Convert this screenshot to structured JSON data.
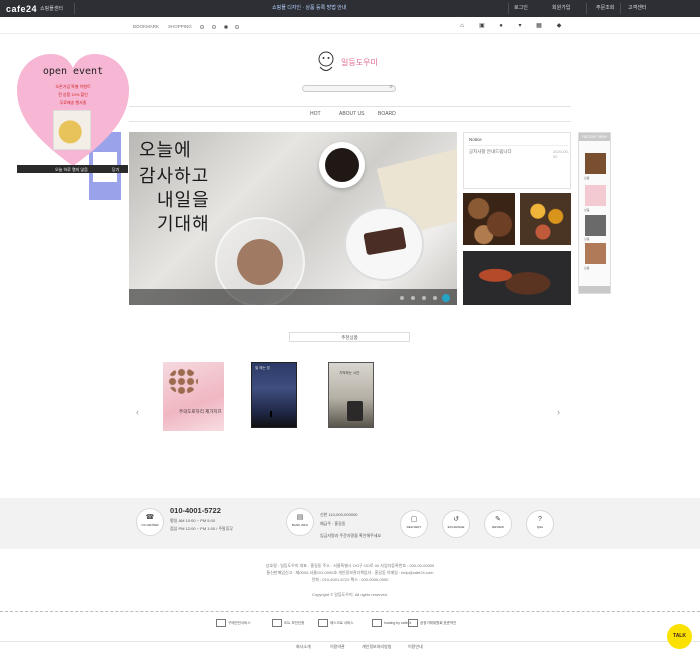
{
  "topbar": {
    "logo": "cafe24",
    "logo_sub": "쇼핑몰센터",
    "notice": "쇼핑몰 디자인 · 상품 등록 방법 안내",
    "items": [
      "로그인",
      "회원가입",
      "주문조회",
      "고객센터"
    ]
  },
  "shopbar": {
    "links": [
      "BOOKMARK",
      "SHOPPING"
    ],
    "icons": [
      "home-icon",
      "lock-icon",
      "user-icon",
      "cart-icon",
      "grid-icon",
      "bag-icon"
    ]
  },
  "brand": {
    "name": "일등도우미"
  },
  "search": {
    "placeholder": ""
  },
  "nav": {
    "items": [
      "HOT",
      "ABOUT US",
      "BOARD"
    ]
  },
  "slider": {
    "caption_lines": [
      "오늘에",
      "감사하고",
      "내일을",
      "기대해"
    ],
    "pages": 5,
    "active_page": 5
  },
  "notice_box": {
    "title": "Notice",
    "row": "공지사항 안내드립니다",
    "date": "2020-00-00"
  },
  "rightbar": {
    "header": "RECENT VIEW",
    "items": [
      "상품",
      "상품",
      "상품",
      "상품"
    ]
  },
  "popup": {
    "title": "open event",
    "lines": [
      "오픈기념 특별 이벤트",
      "전 상품 10% 할인",
      "무료배송 행사중"
    ],
    "close_today": "오늘 하루 열지 않음",
    "close": "닫기"
  },
  "section": {
    "title": "추천상품"
  },
  "products": [
    {
      "label": "주의도로하리 제가지프",
      "kind": "pink-bouquet"
    },
    {
      "label": "별 헤는 밤",
      "kind": "night-sky"
    },
    {
      "label": "기억하는 시간",
      "kind": "coffee-mug"
    }
  ],
  "footer": {
    "phone": "010-4001-5722",
    "hours_1": "평일 AM 10:00 ~ PM 5:00",
    "hours_2": "점심 PM 12:00 ~ PM 1:00 / 주말휴무",
    "bank_1": "신한 110-000-000000",
    "bank_2": "예금주 : 홍길동",
    "bank_3": "입금자명과 주문자명을 확인해주세요",
    "circles": [
      {
        "icon": "headset-icon",
        "label": "CS CENTER"
      },
      {
        "icon": "bank-icon",
        "label": "BANK INFO"
      },
      {
        "icon": "box-icon",
        "label": "DELIVERY"
      },
      {
        "icon": "return-icon",
        "label": "EXCHANGE"
      },
      {
        "icon": "review-icon",
        "label": "REVIEW"
      },
      {
        "icon": "qa-icon",
        "label": "Q&A"
      }
    ],
    "info_lines": [
      "상호명 : 일등도우미  대표 : 홍길동  주소 : 서울특별시 OO구 OO로 00  사업자등록번호 : 000-00-00000",
      "통신판매업신고 : 제0000-서울OO-0000호  개인정보관리책임자 : 홍길동  이메일 : help@cafe24.com",
      "전화 : 010-4001-5722  팩스 : 000-0000-0000",
      "Copyright © 일등도우미. All rights reserved."
    ],
    "certs": [
      "구매안전서비스",
      "SSL 보안인증",
      "에스크로 서비스",
      "hosting by cafe24",
      "공정거래위원회 표준약관"
    ],
    "bottom_links": [
      "회사소개",
      "이용약관",
      "개인정보처리방침",
      "이용안내"
    ],
    "kakao": "TALK"
  }
}
